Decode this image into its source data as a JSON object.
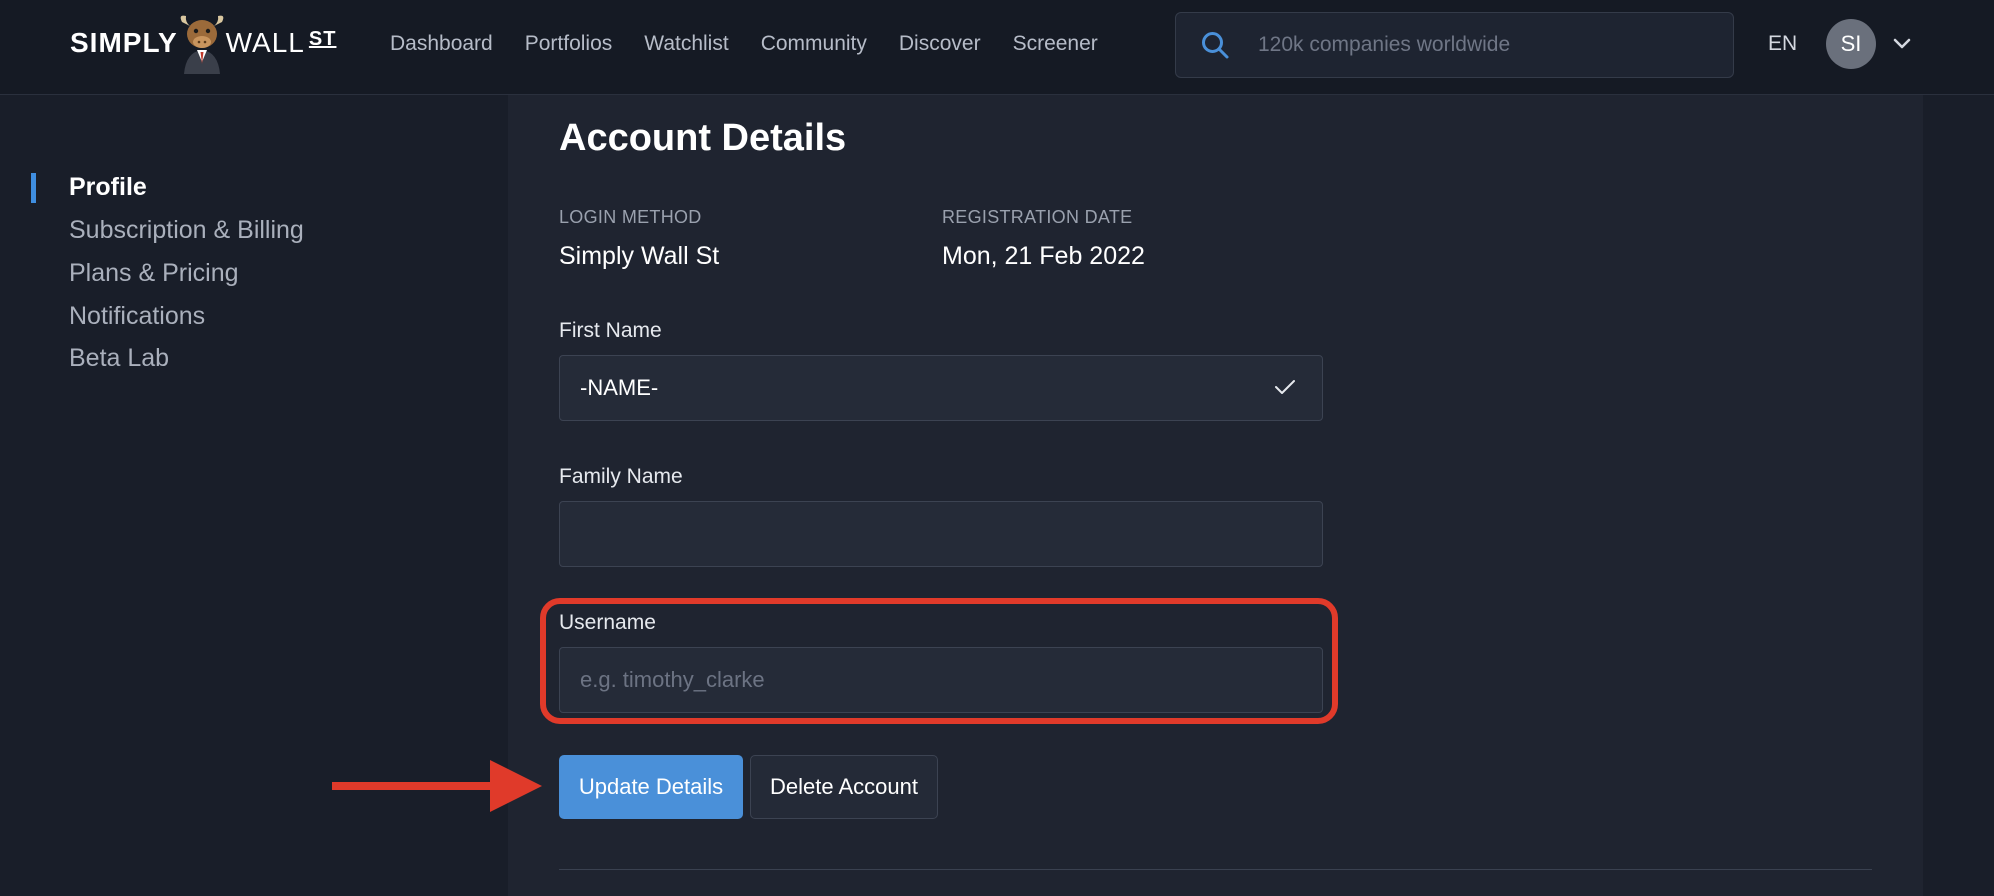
{
  "brand": {
    "word_left": "SIMPLY",
    "word_right": "WALL",
    "word_suffix": "ST",
    "mascot_icon": "bull-mascot-icon"
  },
  "nav": {
    "items": [
      {
        "label": "Dashboard"
      },
      {
        "label": "Portfolios"
      },
      {
        "label": "Watchlist"
      },
      {
        "label": "Community"
      },
      {
        "label": "Discover"
      },
      {
        "label": "Screener"
      }
    ]
  },
  "search": {
    "placeholder": "120k companies worldwide",
    "icon": "search-icon"
  },
  "header": {
    "language": "EN",
    "avatar_initials": "SI",
    "menu_icon": "chevron-down-icon"
  },
  "sidebar": {
    "items": [
      {
        "label": "Profile",
        "active": true
      },
      {
        "label": "Subscription & Billing"
      },
      {
        "label": "Plans & Pricing"
      },
      {
        "label": "Notifications"
      },
      {
        "label": "Beta Lab"
      }
    ]
  },
  "account": {
    "title": "Account Details",
    "login_method": {
      "label": "LOGIN METHOD",
      "value": "Simply Wall St"
    },
    "registration_date": {
      "label": "REGISTRATION DATE",
      "value": "Mon, 21 Feb 2022"
    },
    "first_name": {
      "label": "First Name",
      "value": "-NAME-"
    },
    "family_name": {
      "label": "Family Name",
      "value": ""
    },
    "username": {
      "label": "Username",
      "value": "",
      "placeholder": "e.g. timothy_clarke"
    },
    "update_button": "Update Details",
    "delete_button": "Delete Account"
  },
  "colors": {
    "accent": "#4a90d9",
    "annotation": "#e03a2a",
    "background": "#191e29",
    "panel": "#1f2430"
  }
}
